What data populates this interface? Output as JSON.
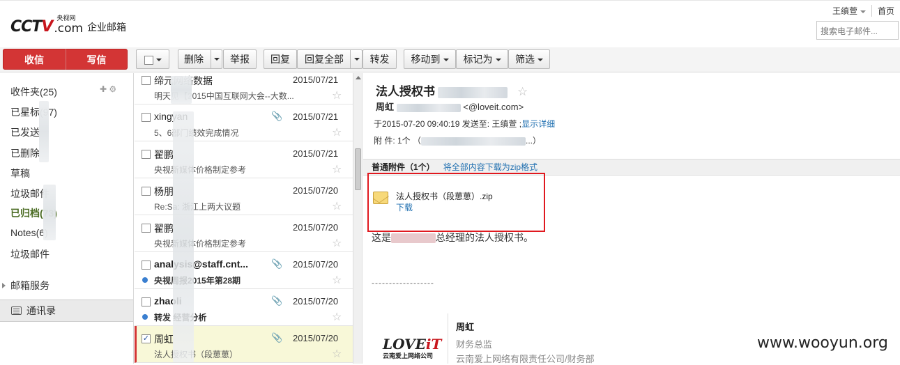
{
  "header": {
    "logo_cctv": "CCTV",
    "logo_com": ".com",
    "logo_yangshi": "央视网",
    "product_title": "企业邮箱",
    "user_name": "王缜萱",
    "home_link": "首页",
    "search_placeholder": "搜索电子邮件..."
  },
  "toolbar": {
    "receive": "收信",
    "compose": "写信",
    "delete": "删除",
    "report": "举报",
    "reply": "回复",
    "reply_all": "回复全部",
    "forward": "转发",
    "move_to": "移动到",
    "mark_as": "标记为",
    "filter": "筛选"
  },
  "sidebar": {
    "folders": [
      {
        "label": "收件夹(25)",
        "active": false
      },
      {
        "label": "已星标(97)",
        "active": false
      },
      {
        "label": "已发送",
        "active": false
      },
      {
        "label": "已删除",
        "active": false
      },
      {
        "label": "草稿",
        "active": false
      },
      {
        "label": "垃圾邮件",
        "active": false
      },
      {
        "label": "已归档(73)",
        "active": true
      },
      {
        "label": "Notes(6)",
        "active": false
      },
      {
        "label": "垃圾邮件",
        "active": false
      }
    ],
    "services": "邮箱服务",
    "contacts": "通讯录"
  },
  "mails": [
    {
      "sender": "缔元网络数据",
      "date": "2015/07/21",
      "subject": "明天见【2015中国互联网大会--大数...",
      "bold": false,
      "attachment": false,
      "unread_dot": false,
      "checked": false,
      "selected": false
    },
    {
      "sender": "xingyan",
      "date": "2015/07/21",
      "subject": "5、6部门绩效完成情况",
      "bold": false,
      "attachment": true,
      "unread_dot": false,
      "checked": false,
      "selected": false
    },
    {
      "sender": "翟鹏",
      "date": "2015/07/21",
      "subject": "央视新媒体价格制定参考",
      "bold": false,
      "attachment": false,
      "unread_dot": false,
      "checked": false,
      "selected": false
    },
    {
      "sender": "杨朋",
      "date": "2015/07/20",
      "subject": "Re:Sa: 浙江上两大议题",
      "bold": false,
      "attachment": false,
      "unread_dot": false,
      "checked": false,
      "selected": false
    },
    {
      "sender": "翟鹏",
      "date": "2015/07/20",
      "subject": "央视新媒体价格制定参考",
      "bold": false,
      "attachment": false,
      "unread_dot": false,
      "checked": false,
      "selected": false
    },
    {
      "sender": "analysis@staff.cnt...",
      "date": "2015/07/20",
      "subject": "央视周报2015年第28期",
      "bold": true,
      "attachment": true,
      "unread_dot": true,
      "checked": false,
      "selected": false
    },
    {
      "sender": "zhaoli",
      "date": "2015/07/20",
      "subject": "转发 经营分析",
      "bold": true,
      "attachment": true,
      "unread_dot": true,
      "checked": false,
      "selected": false
    },
    {
      "sender": "周虹",
      "date": "2015/07/20",
      "subject": "法人授权书（段葸葸）",
      "bold": false,
      "attachment": true,
      "unread_dot": false,
      "checked": true,
      "selected": true
    }
  ],
  "reader": {
    "subject": "法人授权书",
    "from_name": "周虹",
    "from_email": "<@loveit.com>",
    "time_line": "于2015-07-20 09:40:19 发送至: 王缜萱 ;",
    "show_detail": "显示详细",
    "attach_line": "附 件: 1个 （",
    "attach_line_end": "...）",
    "att_bar_label": "普通附件（1个）",
    "att_bar_zip": "将全部内容下载为zip格式",
    "att_name": "法人授权书（段葸葸）.zip",
    "att_download": "下载",
    "body_prefix": "这是",
    "body_suffix": "总经理的法人授权书。",
    "dashes": "------------------",
    "sig_logo": "LOVEiT",
    "sig_logo_cn": "云南爱上网络公司",
    "sig_name": "周虹",
    "sig_title": "财务总监",
    "sig_company": "云南爱上网络有限责任公司/财务部"
  },
  "watermark": "www.wooyun.org"
}
